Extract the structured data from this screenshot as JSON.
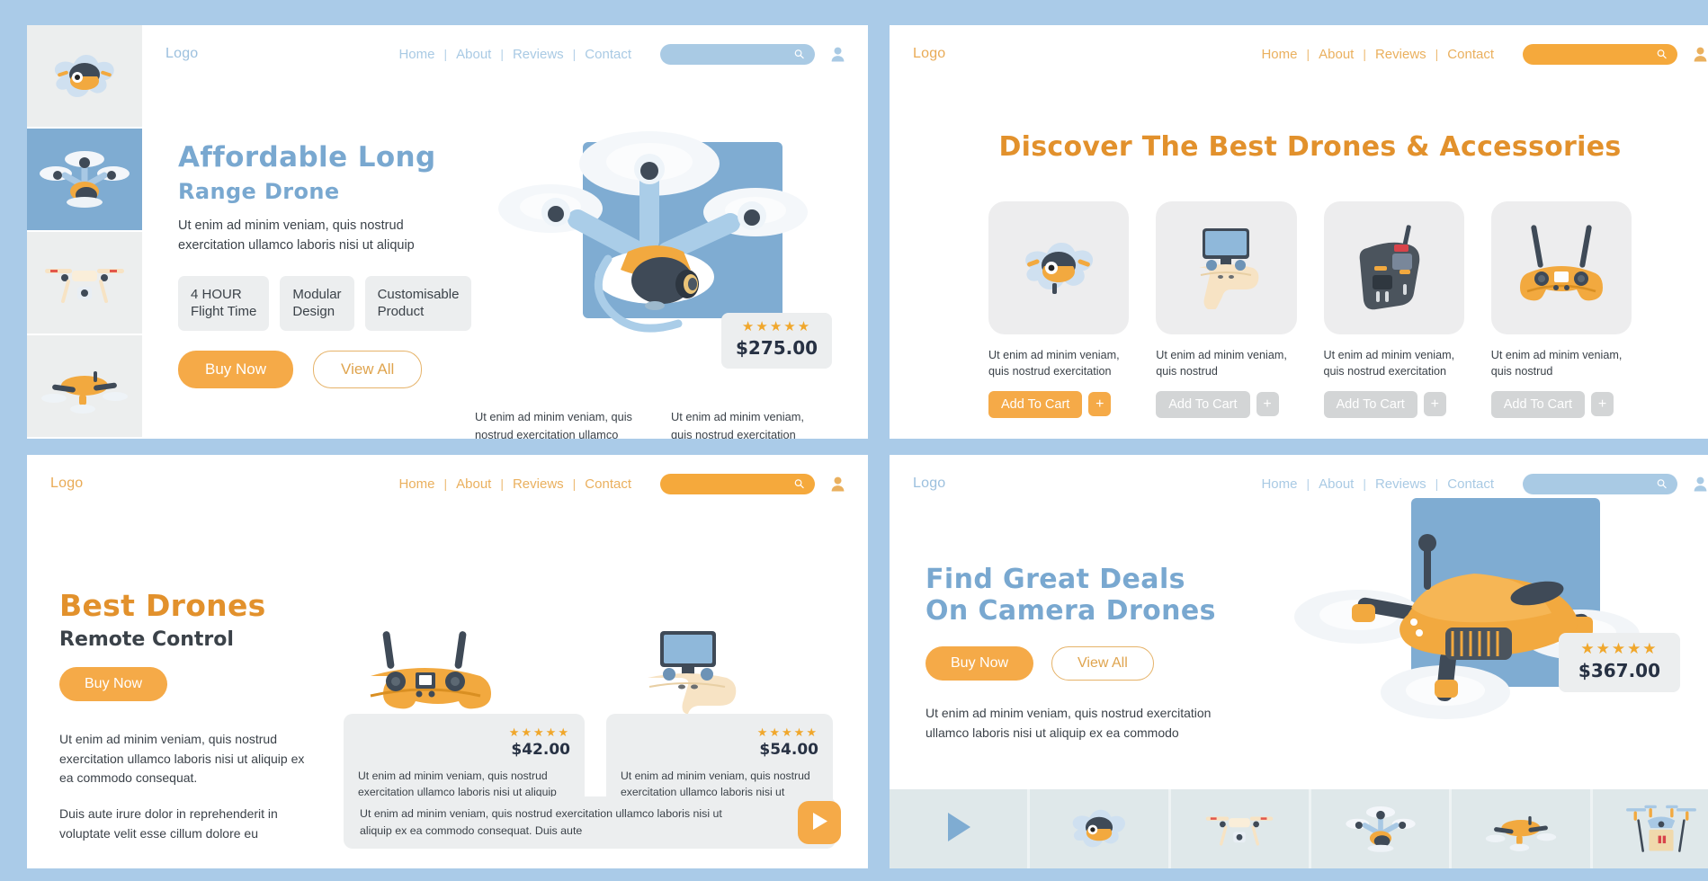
{
  "theme": {
    "page_bg": "#aacbe8",
    "orange": "#f5aa48",
    "orange_dark": "#e2912c",
    "blue": "#79a8d0",
    "blue_mid": "#7facd2",
    "grey_card": "#eceeef",
    "star": "#f0a72c",
    "text_dark": "#3b4249"
  },
  "panel1": {
    "nav": {
      "logo": "Logo",
      "links": [
        "Home",
        "About",
        "Reviews",
        "Contact"
      ],
      "separator": "|",
      "search_placeholder": "",
      "search_value": "",
      "search_icon": "search-icon",
      "user_icon": "user-account-icon"
    },
    "hero": {
      "title_line1": "Affordable Long",
      "title_line2": "Range Drone",
      "lead": "Ut enim ad minim veniam, quis nostrud exercitation ullamco laboris nisi ut aliquip",
      "chips": [
        {
          "line1": "4 HOUR",
          "line2": "Flight Time"
        },
        {
          "line1": "Modular",
          "line2": "Design"
        },
        {
          "line1": "Customisable",
          "line2": "Product"
        }
      ],
      "primary_button": "Buy Now",
      "ghost_button": "View All",
      "col_left": "Ut enim ad minim veniam, quis nostrud exercitation ullamco laboris nisi ut aliquip",
      "col_right": "Ut enim ad minim veniam, quis nostrud exercitation ullamco",
      "price": "$275.00",
      "stars": "★★★★★",
      "rating": 5
    },
    "thumbnails": [
      {
        "name": "drone-thumb-1",
        "active": false
      },
      {
        "name": "drone-thumb-2",
        "active": true
      },
      {
        "name": "drone-thumb-3",
        "active": false
      },
      {
        "name": "drone-thumb-4",
        "active": false
      }
    ]
  },
  "panel2": {
    "nav": {
      "logo": "Logo",
      "links": [
        "Home",
        "About",
        "Reviews",
        "Contact"
      ],
      "separator": "|",
      "search_placeholder": "",
      "search_value": "",
      "search_icon": "search-icon",
      "user_icon": "user-account-icon"
    },
    "title": "Discover The Best Drones & Accessories",
    "products": [
      {
        "image": "quadcopter-drone-icon",
        "desc": "Ut enim ad minim veniam, quis nostrud exercitation",
        "cart_label": "Add To Cart",
        "plus_label": "+",
        "enabled": true
      },
      {
        "image": "controller-with-screen-icon",
        "desc": "Ut enim ad minim veniam, quis nostrud",
        "cart_label": "Add To Cart",
        "plus_label": "+",
        "enabled": false
      },
      {
        "image": "black-transmitter-icon",
        "desc": "Ut enim ad minim veniam, quis nostrud exercitation",
        "cart_label": "Add To Cart",
        "plus_label": "+",
        "enabled": false
      },
      {
        "image": "orange-transmitter-icon",
        "desc": "Ut enim ad minim veniam, quis nostrud",
        "cart_label": "Add To Cart",
        "plus_label": "+",
        "enabled": false
      }
    ]
  },
  "panel3": {
    "nav": {
      "logo": "Logo",
      "links": [
        "Home",
        "About",
        "Reviews",
        "Contact"
      ],
      "separator": "|",
      "search_placeholder": "",
      "search_value": "",
      "search_icon": "search-icon",
      "user_icon": "user-account-icon"
    },
    "title": "Best Drones",
    "subtitle": "Remote Control",
    "primary_button": "Buy Now",
    "paragraph1": "Ut enim ad minim veniam, quis nostrud exercitation ullamco laboris nisi ut aliquip ex ea commodo consequat.",
    "paragraph2": "Duis aute irure dolor in reprehenderit in voluptate velit esse cillum dolore eu",
    "cards": [
      {
        "image": "orange-transmitter-icon",
        "stars": "★★★★★",
        "rating": 5,
        "price": "$42.00",
        "desc": "Ut enim ad minim veniam, quis nostrud exercitation ullamco laboris nisi ut aliquip ex ea commodo consequat. Duis aute irure"
      },
      {
        "image": "controller-with-screen-icon",
        "stars": "★★★★★",
        "rating": 5,
        "price": "$54.00",
        "desc": "Ut enim ad minim veniam, quis nostrud exercitation ullamco laboris nisi ut aliquip ex ea commodo"
      }
    ],
    "video": {
      "text": "Ut enim ad minim veniam, quis nostrud exercitation ullamco laboris nisi ut aliquip ex ea commodo consequat. Duis aute",
      "play_icon": "play-icon"
    }
  },
  "panel4": {
    "nav": {
      "logo": "Logo",
      "links": [
        "Home",
        "About",
        "Reviews",
        "Contact"
      ],
      "separator": "|",
      "search_placeholder": "",
      "search_value": "",
      "search_icon": "search-icon",
      "user_icon": "user-account-icon"
    },
    "hero": {
      "title_line1": "Find Great Deals",
      "title_line2": "On Camera Drones",
      "primary_button": "Buy Now",
      "ghost_button": "View All",
      "lead": "Ut enim ad minim veniam, quis nostrud exercitation ullamco laboris nisi ut aliquip ex ea commodo",
      "price": "$367.00",
      "stars": "★★★★★",
      "rating": 5
    },
    "strip": [
      {
        "name": "play-icon",
        "type": "play"
      },
      {
        "name": "drone-thumb-round-blue",
        "type": "image"
      },
      {
        "name": "drone-thumb-cream-camera",
        "type": "image"
      },
      {
        "name": "drone-thumb-blue-quad",
        "type": "image"
      },
      {
        "name": "drone-thumb-orange",
        "type": "image"
      },
      {
        "name": "drone-thumb-delivery",
        "type": "image"
      }
    ]
  }
}
